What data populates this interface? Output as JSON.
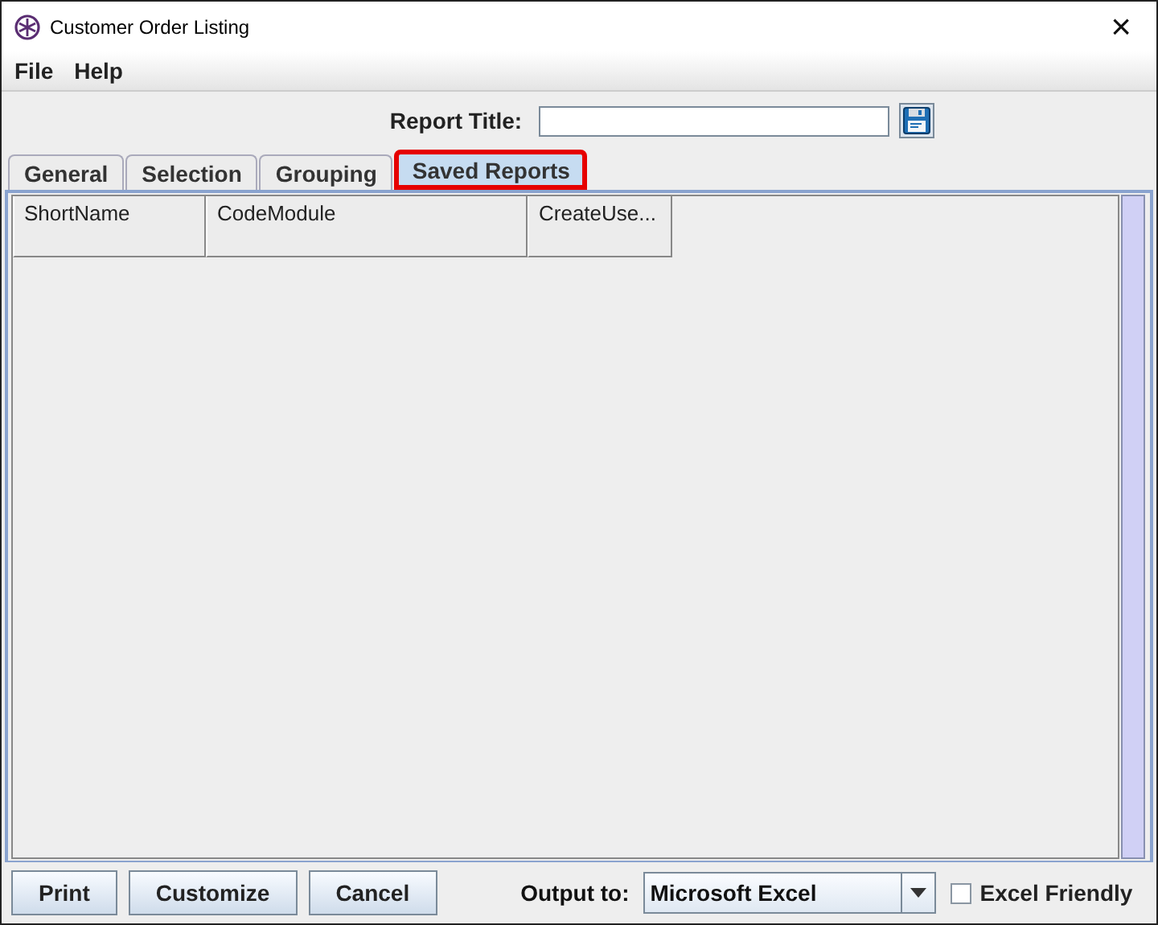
{
  "window": {
    "title": "Customer Order Listing",
    "close": "×"
  },
  "menu": [
    {
      "label": "File"
    },
    {
      "label": "Help"
    }
  ],
  "report_title": {
    "label": "Report Title:"
  },
  "tabs": [
    {
      "label": "General",
      "selected": false
    },
    {
      "label": "Selection",
      "selected": false
    },
    {
      "label": "Grouping",
      "selected": false
    },
    {
      "label": "Saved Reports",
      "selected": true
    }
  ],
  "table": {
    "columns": [
      "ShortName",
      "CodeModule",
      "CreateUse..."
    ]
  },
  "buttons": [
    "Print",
    "Customize",
    "Cancel"
  ],
  "output": {
    "label": "Output to:",
    "value": "Microsoft Excel"
  },
  "excel_friendly": {
    "label": "Excel Friendly",
    "checked": false
  }
}
